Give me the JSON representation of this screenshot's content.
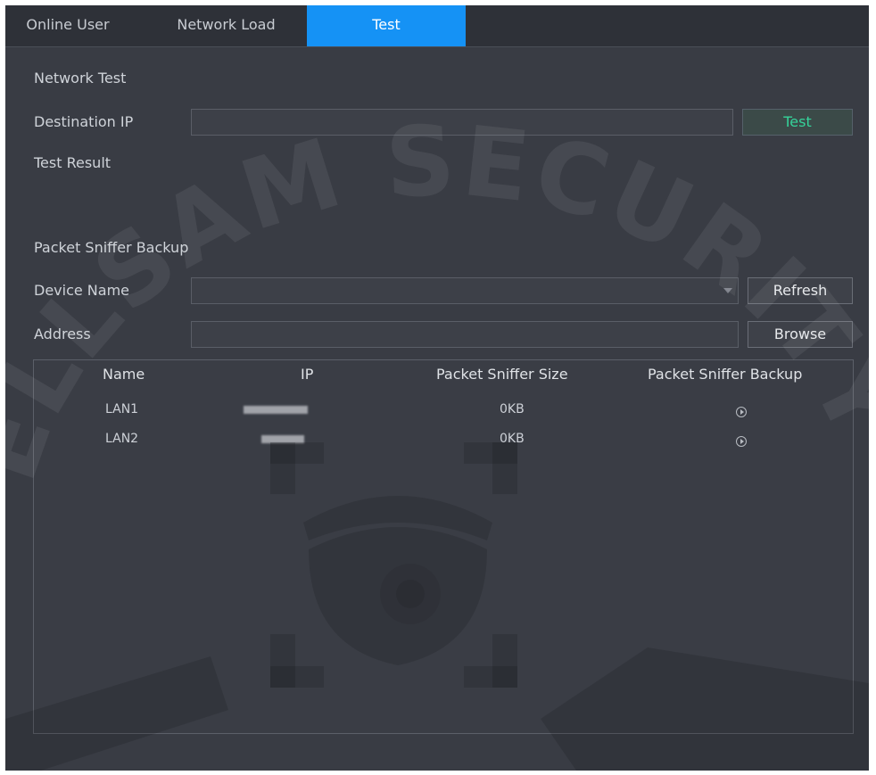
{
  "tabs": [
    {
      "label": "Online User",
      "active": false
    },
    {
      "label": "Network Load",
      "active": false
    },
    {
      "label": "Test",
      "active": true
    }
  ],
  "network_test": {
    "section_title": "Network Test",
    "destination_ip_label": "Destination IP",
    "destination_ip_value": "",
    "test_button": "Test",
    "test_result_label": "Test Result",
    "test_result_value": ""
  },
  "packet_sniffer": {
    "section_title": "Packet Sniffer Backup",
    "device_name_label": "Device Name",
    "device_name_value": "",
    "refresh_button": "Refresh",
    "address_label": "Address",
    "address_value": "",
    "browse_button": "Browse",
    "columns": [
      "Name",
      "IP",
      "Packet Sniffer Size",
      "Packet Sniffer Backup"
    ],
    "rows": [
      {
        "name": "LAN1",
        "size": "0KB"
      },
      {
        "name": "LAN2",
        "size": "0KB"
      }
    ]
  },
  "watermark": {
    "text": "ELLSAM SECURITY"
  },
  "colors": {
    "background": "#393c44",
    "tab_active": "#1592f5",
    "test_button_text": "#35d39a"
  }
}
